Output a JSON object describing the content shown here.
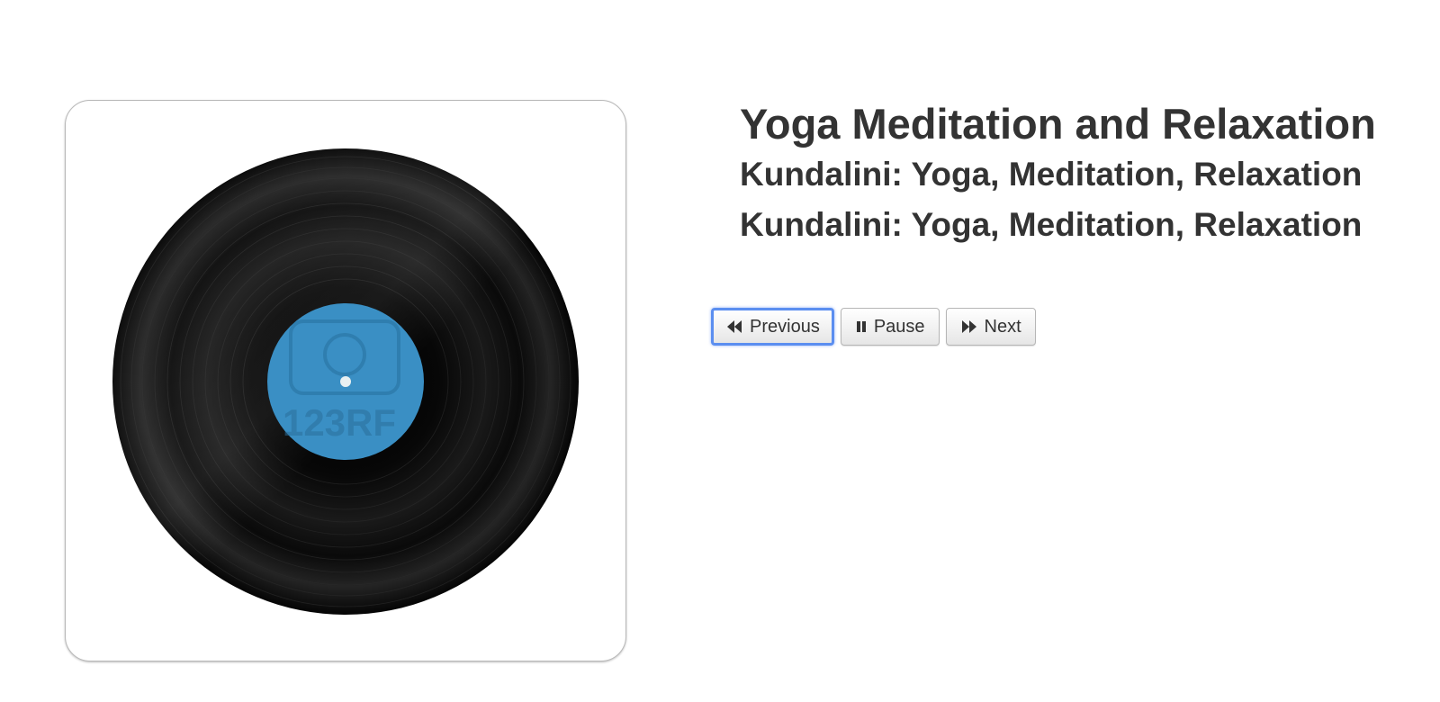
{
  "album": {
    "title": "Yoga Meditation and Relaxation",
    "subtitle_1": "Kundalini: Yoga, Meditation, Relaxation",
    "subtitle_2": "Kundalini: Yoga, Meditation, Relaxation",
    "artwork": {
      "icon": "vinyl-record-icon",
      "watermark": "123RF",
      "label_color": "#3a8fc4",
      "record_color": "#050505"
    }
  },
  "controls": {
    "previous": {
      "label": "Previous",
      "icon": "rewind-icon"
    },
    "pause": {
      "label": "Pause",
      "icon": "pause-icon"
    },
    "next": {
      "label": "Next",
      "icon": "fast-forward-icon"
    }
  },
  "colors": {
    "text": "#333333",
    "focus_ring": "#5b8ef0"
  }
}
